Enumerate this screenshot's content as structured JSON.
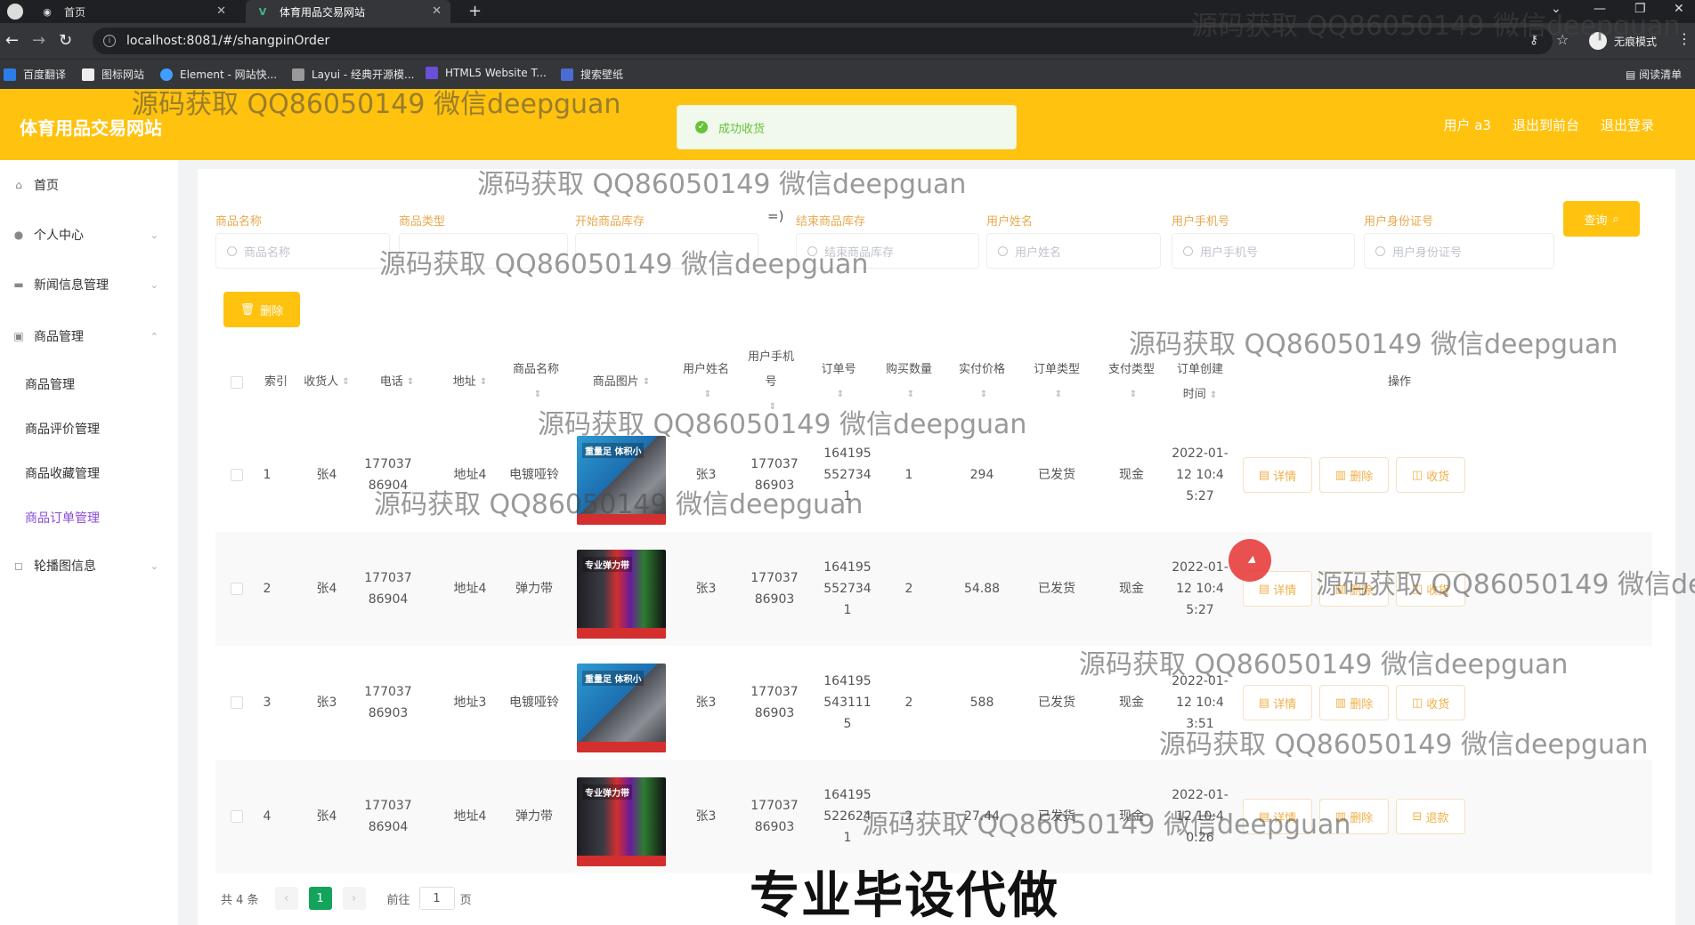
{
  "browser": {
    "tabs": [
      {
        "label": "首页"
      },
      {
        "label": "体育用品交易网站"
      }
    ],
    "url": "localhost:8081/#/shangpinOrder",
    "profile_label": "无痕模式",
    "bookmarks": [
      {
        "label": "百度翻译",
        "icon": "translate-icon",
        "color": "#2b7de9"
      },
      {
        "label": "图标网站",
        "icon": "bird-icon",
        "color": "#222222"
      },
      {
        "label": "Element - 网站快...",
        "icon": "element-icon",
        "color": "#409eff"
      },
      {
        "label": "Layui - 经典开源模...",
        "icon": "layui-icon",
        "color": "#555555"
      },
      {
        "label": "HTML5 Website T...",
        "icon": "html5-icon",
        "color": "#6b4fd8"
      },
      {
        "label": "搜索壁纸",
        "icon": "wallpaper-icon",
        "color": "#4a6cd4"
      }
    ],
    "reading_list": "阅读清单"
  },
  "header": {
    "brand": "体育用品交易网站",
    "links": [
      "用户 a3",
      "退出到前台",
      "退出登录"
    ],
    "accent": "#ffc20e"
  },
  "toast": {
    "text": "成功收货",
    "color": "#67c23a"
  },
  "sidebar": {
    "items": [
      {
        "label": "首页",
        "icon": "home-icon"
      },
      {
        "label": "个人中心",
        "icon": "user-icon"
      },
      {
        "label": "新闻信息管理",
        "icon": "news-icon"
      },
      {
        "label": "商品管理",
        "icon": "goods-icon"
      },
      {
        "label": "轮播图信息",
        "icon": "carousel-icon"
      }
    ],
    "sub_items": [
      {
        "label": "商品管理"
      },
      {
        "label": "商品评价管理"
      },
      {
        "label": "商品收藏管理"
      },
      {
        "label": "商品订单管理",
        "active": true
      }
    ]
  },
  "filters": {
    "fields": [
      {
        "label": "商品名称",
        "placeholder": "商品名称"
      },
      {
        "label": "商品类型",
        "placeholder": ""
      },
      {
        "label": "开始商品库存",
        "placeholder": ""
      },
      {
        "label": "结束商品库存",
        "placeholder": "结束商品库存"
      },
      {
        "label": "用户姓名",
        "placeholder": "用户姓名"
      },
      {
        "label": "用户手机号",
        "placeholder": "用户手机号"
      },
      {
        "label": "用户身份证号",
        "placeholder": "用户身份证号"
      }
    ],
    "range_separator": "=)",
    "query_label": "查询",
    "delete_label": "删除"
  },
  "table": {
    "columns": [
      {
        "label": "索引",
        "sortable": false
      },
      {
        "label": "收货人",
        "sortable": true
      },
      {
        "label": "电话",
        "sortable": true
      },
      {
        "label": "地址",
        "sortable": true
      },
      {
        "label": "商品名称",
        "sortable": true
      },
      {
        "label": "商品图片",
        "sortable": true
      },
      {
        "label": "用户姓名",
        "sortable": true
      },
      {
        "label": "用户手机号",
        "sortable": true
      },
      {
        "label": "订单号",
        "sortable": true
      },
      {
        "label": "购买数量",
        "sortable": true
      },
      {
        "label": "实付价格",
        "sortable": true
      },
      {
        "label": "订单类型",
        "sortable": true
      },
      {
        "label": "支付类型",
        "sortable": true
      },
      {
        "label": "订单创建时间",
        "sortable": true
      },
      {
        "label": "操作",
        "sortable": false
      }
    ],
    "rows": [
      {
        "index": "1",
        "receiver": "张4",
        "phone": "17703786904",
        "address": "地址4",
        "product": "电镀哑铃",
        "image": "dumbbell",
        "image_tag": "重量足 体积小",
        "user": "张3",
        "user_phone": "17703786903",
        "order_no": "1641955527341",
        "qty": "1",
        "price": "294",
        "order_type": "已发货",
        "pay_type": "现金",
        "created": "2022-01-12 10:45:27",
        "actions": [
          "详情",
          "删除",
          "收货"
        ]
      },
      {
        "index": "2",
        "receiver": "张4",
        "phone": "17703786904",
        "address": "地址4",
        "product": "弹力带",
        "image": "band",
        "image_tag": "专业弹力带",
        "user": "张3",
        "user_phone": "17703786903",
        "order_no": "1641955527341",
        "qty": "2",
        "price": "54.88",
        "order_type": "已发货",
        "pay_type": "现金",
        "created": "2022-01-12 10:45:27",
        "actions": [
          "详情",
          "删除",
          "收货"
        ]
      },
      {
        "index": "3",
        "receiver": "张3",
        "phone": "17703786903",
        "address": "地址3",
        "product": "电镀哑铃",
        "image": "dumbbell",
        "image_tag": "重量足 体积小",
        "user": "张3",
        "user_phone": "17703786903",
        "order_no": "1641955431115",
        "qty": "2",
        "price": "588",
        "order_type": "已发货",
        "pay_type": "现金",
        "created": "2022-01-12 10:43:51",
        "actions": [
          "详情",
          "删除",
          "收货"
        ]
      },
      {
        "index": "4",
        "receiver": "张4",
        "phone": "17703786904",
        "address": "地址4",
        "product": "弹力带",
        "image": "band",
        "image_tag": "专业弹力带",
        "user": "张3",
        "user_phone": "17703786903",
        "order_no": "1641955226241",
        "qty": "2",
        "price": "27.44",
        "order_type": "已发货",
        "pay_type": "现金",
        "created": "2022-01-12 10:40:26",
        "actions": [
          "详情",
          "删除",
          "退款"
        ]
      }
    ]
  },
  "pager": {
    "total": "共 4 条",
    "current": "1",
    "goto_prefix": "前往",
    "goto_value": "1",
    "goto_suffix": "页"
  },
  "overlay": {
    "watermark": "源码获取 QQ86050149 微信deepguan",
    "caption": "专业毕设代做"
  }
}
